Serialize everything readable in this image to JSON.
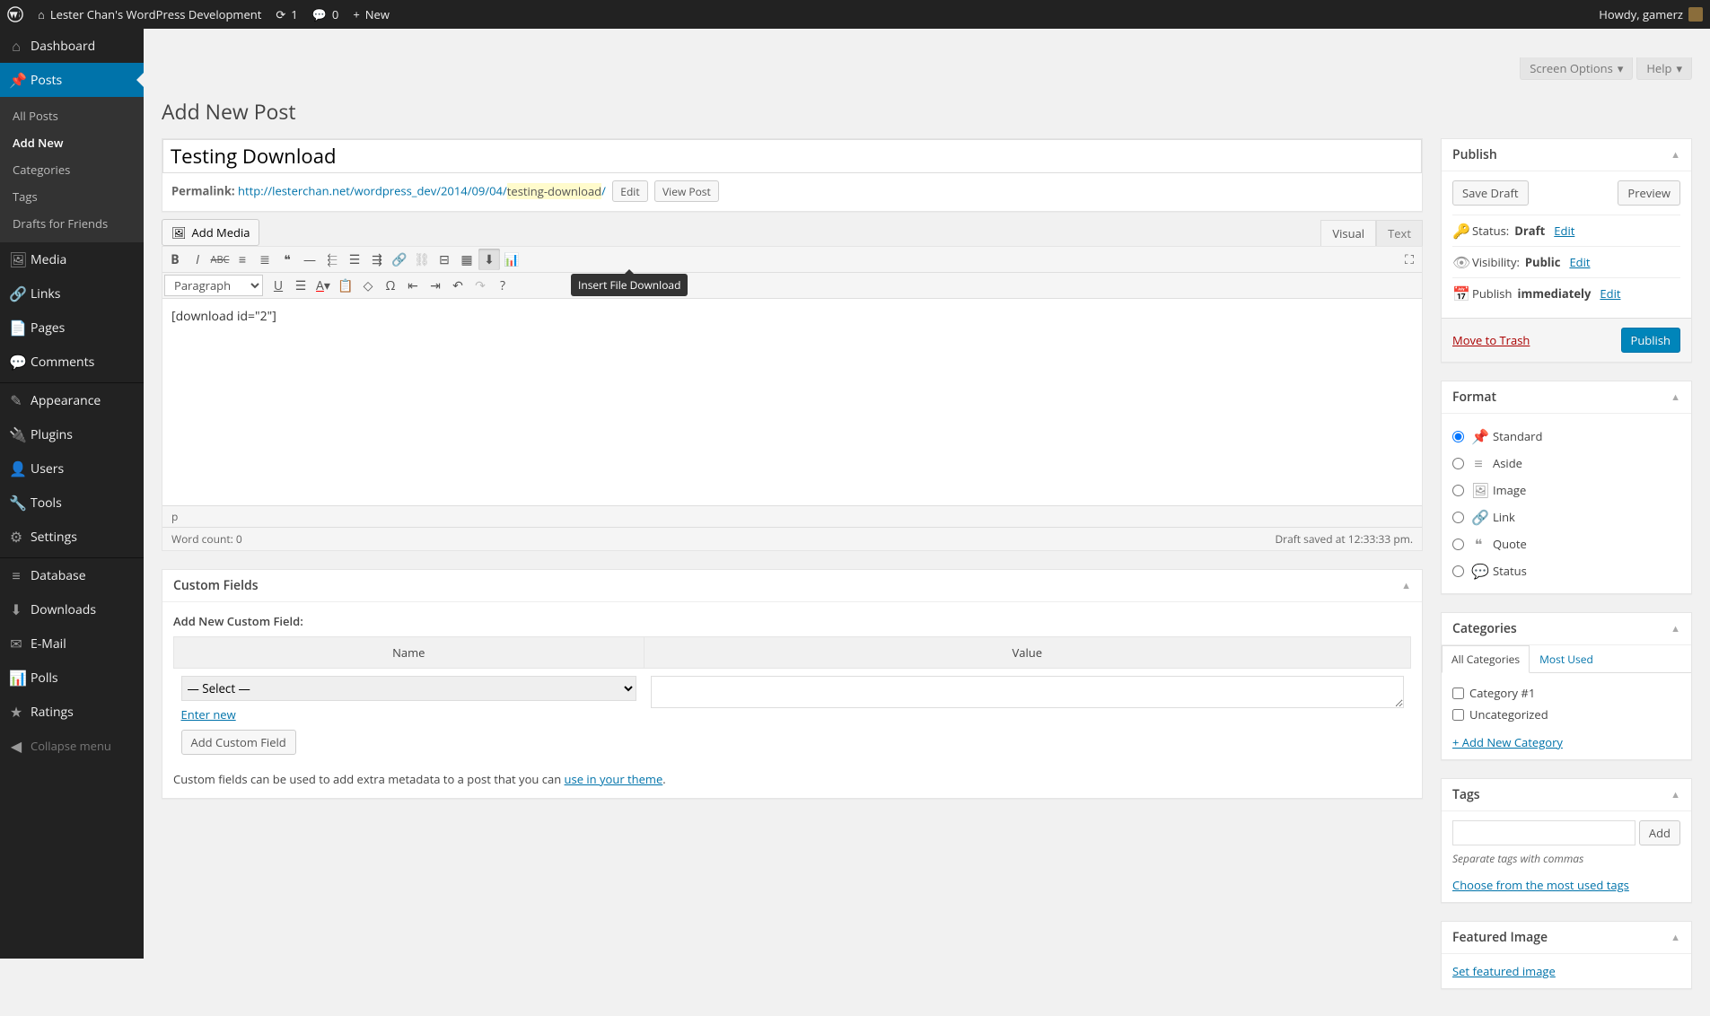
{
  "adminbar": {
    "site": "Lester Chan's WordPress Development",
    "updates": "1",
    "comments": "0",
    "new": "New",
    "howdy": "Howdy, gamerz"
  },
  "screenmeta": {
    "screen_options": "Screen Options",
    "help": "Help"
  },
  "sidebar": {
    "items": [
      {
        "icon": "⌂",
        "label": "Dashboard"
      },
      {
        "icon": "📌",
        "label": "Posts",
        "current": true,
        "submenu": [
          {
            "label": "All Posts"
          },
          {
            "label": "Add New",
            "current": true
          },
          {
            "label": "Categories"
          },
          {
            "label": "Tags"
          },
          {
            "label": "Drafts for Friends"
          }
        ]
      },
      {
        "icon": "🖼",
        "label": "Media"
      },
      {
        "icon": "🔗",
        "label": "Links"
      },
      {
        "icon": "📄",
        "label": "Pages"
      },
      {
        "icon": "💬",
        "label": "Comments"
      },
      {
        "sep": true
      },
      {
        "icon": "✎",
        "label": "Appearance"
      },
      {
        "icon": "🔌",
        "label": "Plugins"
      },
      {
        "icon": "👤",
        "label": "Users"
      },
      {
        "icon": "🔧",
        "label": "Tools"
      },
      {
        "icon": "⚙",
        "label": "Settings"
      },
      {
        "sep": true
      },
      {
        "icon": "≡",
        "label": "Database"
      },
      {
        "icon": "⬇",
        "label": "Downloads"
      },
      {
        "icon": "✉",
        "label": "E-Mail"
      },
      {
        "icon": "📊",
        "label": "Polls"
      },
      {
        "icon": "★",
        "label": "Ratings"
      },
      {
        "icon": "◀",
        "label": "Collapse menu",
        "collapse": true
      }
    ]
  },
  "page": {
    "title": "Add New Post"
  },
  "post": {
    "title": "Testing Download",
    "permalink_label": "Permalink:",
    "permalink_base": "http://lesterchan.net/wordpress_dev/2014/09/04/",
    "slug": "testing-download",
    "edit": "Edit",
    "view": "View Post"
  },
  "media": {
    "add": "Add Media"
  },
  "tabs": {
    "visual": "Visual",
    "text": "Text"
  },
  "toolbar": {
    "paragraph": "Paragraph",
    "tooltip": "Insert File Download"
  },
  "editor": {
    "content": "[download id=\"2\"]",
    "path": "p",
    "wordcount": "Word count: 0",
    "saved": "Draft saved at 12:33:33 pm."
  },
  "customfields": {
    "title": "Custom Fields",
    "subtitle": "Add New Custom Field:",
    "name_h": "Name",
    "value_h": "Value",
    "select_default": "— Select —",
    "enter_new": "Enter new",
    "add_btn": "Add Custom Field",
    "note_pre": "Custom fields can be used to add extra metadata to a post that you can ",
    "note_link": "use in your theme",
    "note_post": "."
  },
  "publish": {
    "title": "Publish",
    "save_draft": "Save Draft",
    "preview": "Preview",
    "status_label": "Status:",
    "status_value": "Draft",
    "edit": "Edit",
    "visibility_label": "Visibility:",
    "visibility_value": "Public",
    "publish_label": "Publish",
    "publish_value": "immediately",
    "trash": "Move to Trash",
    "publish_btn": "Publish"
  },
  "format": {
    "title": "Format",
    "options": [
      "Standard",
      "Aside",
      "Image",
      "Link",
      "Quote",
      "Status"
    ]
  },
  "categories": {
    "title": "Categories",
    "tab_all": "All Categories",
    "tab_most": "Most Used",
    "items": [
      "Category #1",
      "Uncategorized"
    ],
    "add": "+ Add New Category"
  },
  "tags": {
    "title": "Tags",
    "add": "Add",
    "howto": "Separate tags with commas",
    "choose": "Choose from the most used tags"
  },
  "featured": {
    "title": "Featured Image",
    "set": "Set featured image"
  }
}
